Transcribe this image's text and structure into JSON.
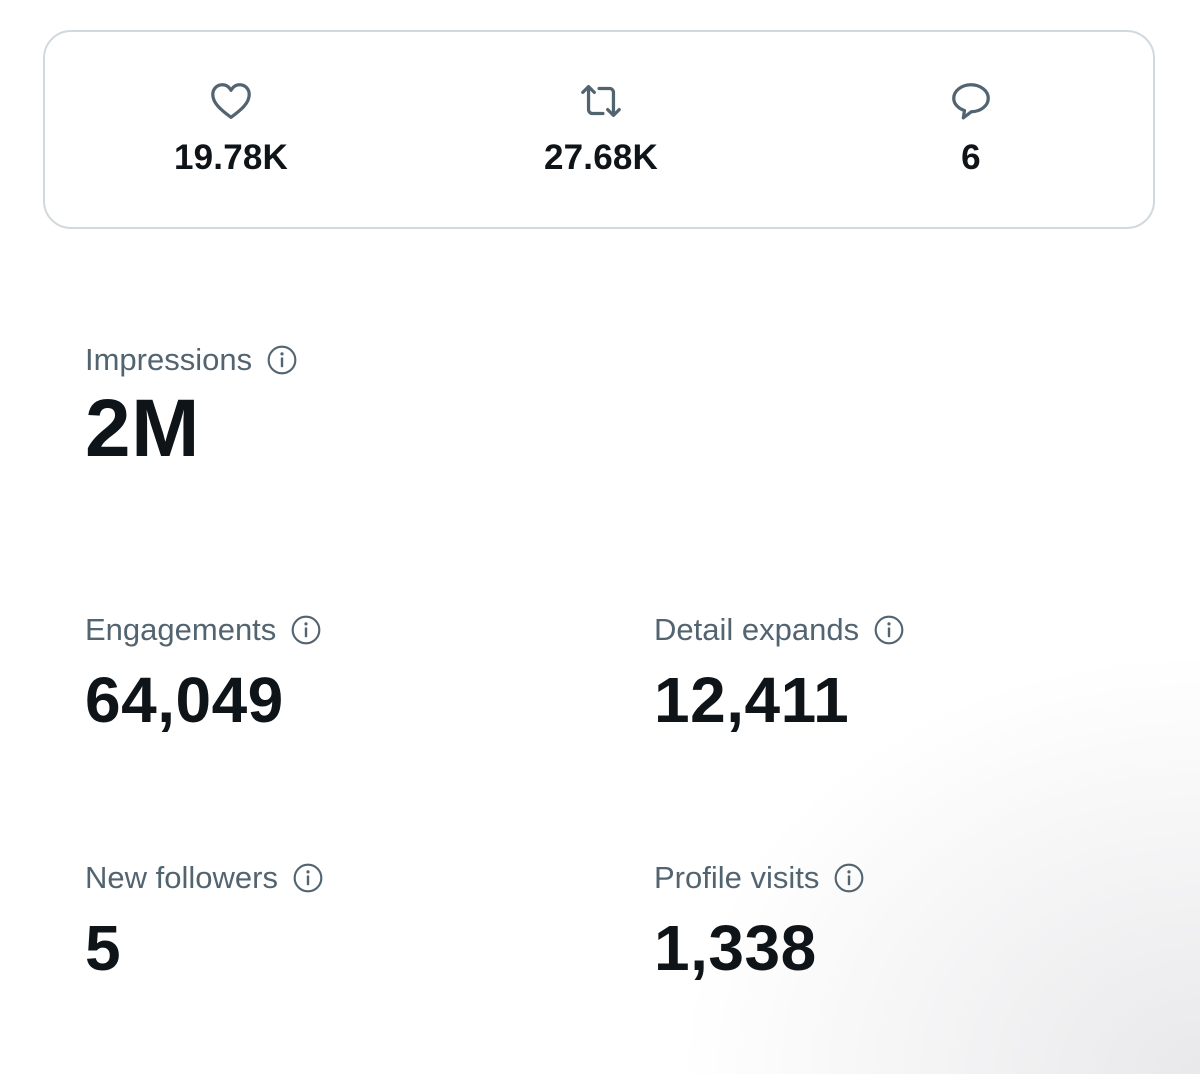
{
  "engagement_row": [
    {
      "icon": "heart-icon",
      "count": "19.78K"
    },
    {
      "icon": "retweet-icon",
      "count": "27.68K"
    },
    {
      "icon": "reply-icon",
      "count": "6"
    }
  ],
  "metrics": {
    "impressions": {
      "label": "Impressions",
      "value": "2M",
      "icon": "info-icon"
    },
    "engagements": {
      "label": "Engagements",
      "value": "64,049",
      "icon": "info-icon"
    },
    "detail_expands": {
      "label": "Detail expands",
      "value": "12,411",
      "icon": "info-icon"
    },
    "new_followers": {
      "label": "New followers",
      "value": "5",
      "icon": "info-icon"
    },
    "profile_visits": {
      "label": "Profile visits",
      "value": "1,338",
      "icon": "info-icon"
    }
  },
  "colors": {
    "text_primary": "#0f1419",
    "text_secondary": "#536471",
    "card_border": "#cfd9de",
    "background": "#ffffff"
  }
}
